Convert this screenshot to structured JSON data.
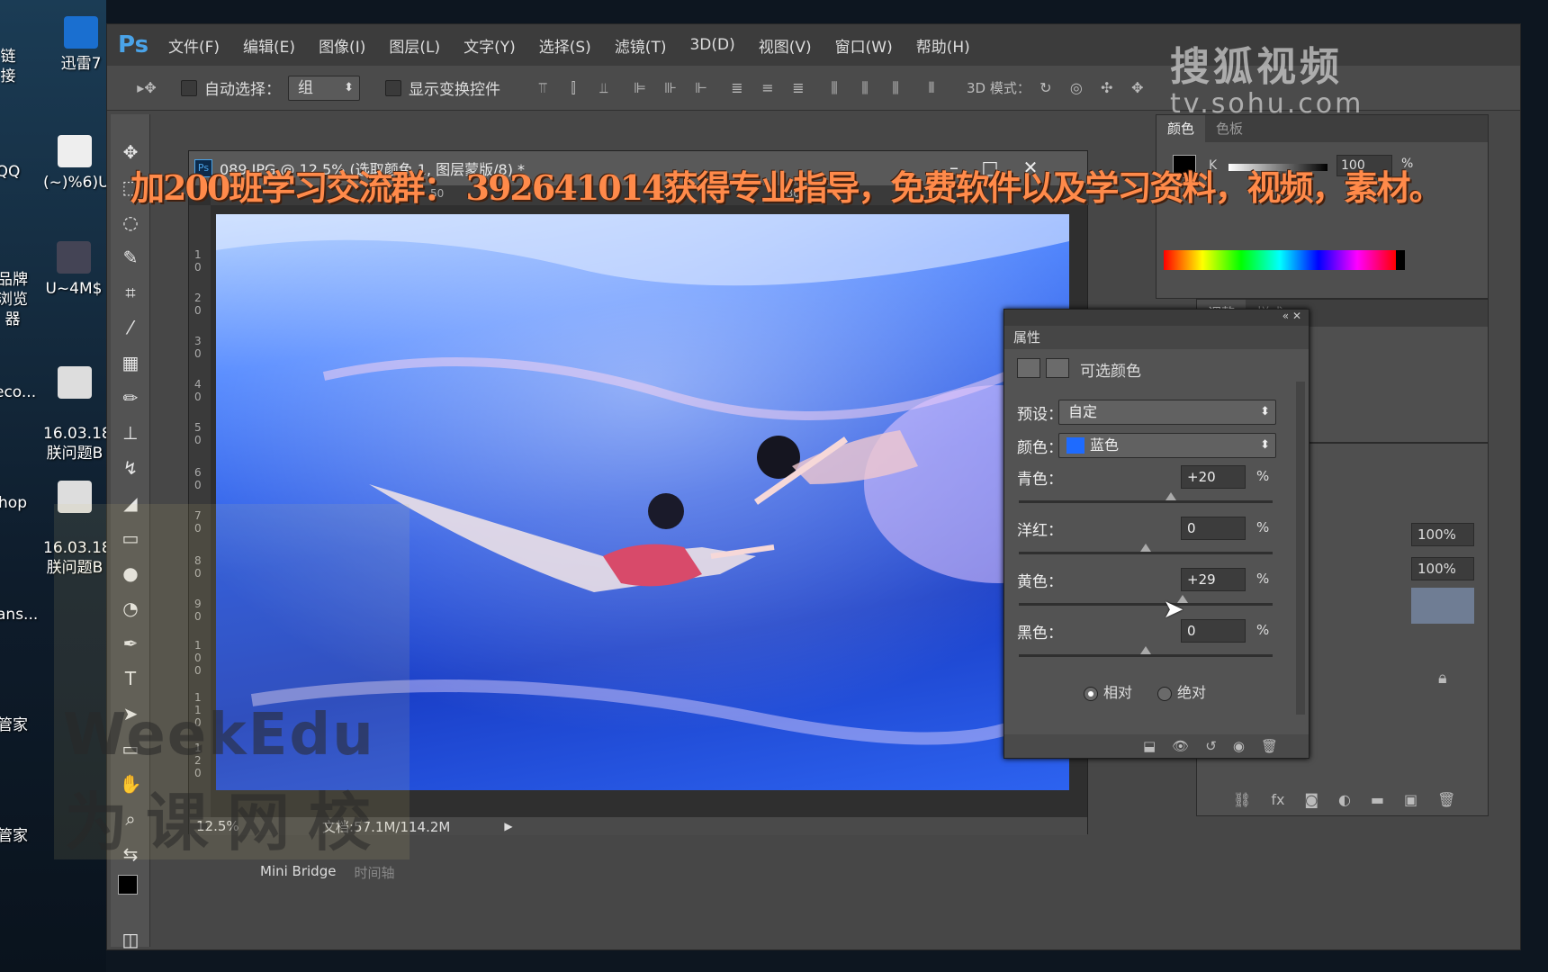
{
  "desktop": {
    "icons": [
      {
        "label": "迅雷7"
      },
      {
        "label": "链接"
      },
      {
        "label": "QQ"
      },
      {
        "label": "(~)%6)U"
      },
      {
        "label": "品牌浏览器"
      },
      {
        "label": "U~4M$"
      },
      {
        "label": "eco..."
      },
      {
        "label": "16.03.18\n朕问题B"
      },
      {
        "label": "hop"
      },
      {
        "label": "16.03.18\n朕问题B"
      },
      {
        "label": "ans..."
      },
      {
        "label": "管家"
      },
      {
        "label": "管家"
      }
    ]
  },
  "app": {
    "logo": "Ps",
    "menu": [
      "文件(F)",
      "编辑(E)",
      "图像(I)",
      "图层(L)",
      "文字(Y)",
      "选择(S)",
      "滤镜(T)",
      "3D(D)",
      "视图(V)",
      "窗口(W)",
      "帮助(H)"
    ]
  },
  "options": {
    "auto_select_label": "自动选择：",
    "auto_select_value": "组",
    "show_transform_label": "显示变换控件",
    "mode_3d_label": "3D 模式："
  },
  "document": {
    "tab_title": "089.JPG @ 12.5% (选取颜色 1, 图层蒙版/8) *",
    "zoom": "12.5%",
    "doc_size": "文档:57.1M/114.2M",
    "ruler_top": [
      "50",
      "130"
    ],
    "ruler_left": [
      "1 0",
      "2 0",
      "3 0",
      "4 0",
      "5 0",
      "6 0",
      "7 0",
      "8 0",
      "9 0",
      "1 0 0",
      "1 1 0",
      "1 2 0"
    ]
  },
  "color_panel": {
    "tabs": [
      "颜色",
      "色板"
    ],
    "k_label": "K",
    "k_value": "100",
    "pct": "%"
  },
  "adj_panel": {
    "tabs": [
      "调整",
      "样式"
    ]
  },
  "layers_panel": {
    "opacity": "100%",
    "fill": "100%"
  },
  "properties": {
    "title": "属性",
    "adj_name": "可选颜色",
    "preset_label": "预设：",
    "preset_value": "自定",
    "colors_label": "颜色：",
    "colors_value": "蓝色",
    "swatch_color": "#1e6bff",
    "sliders": [
      {
        "label": "青色：",
        "value": "+20",
        "level": 0.6
      },
      {
        "label": "洋红：",
        "value": "0",
        "level": 0.5
      },
      {
        "label": "黄色：",
        "value": "+29",
        "level": 0.645
      },
      {
        "label": "黑色：",
        "value": "0",
        "level": 0.5
      }
    ],
    "pct": "%",
    "mode_relative": "相对",
    "mode_absolute": "绝对"
  },
  "bottom_tabs": [
    "Mini Bridge",
    "时间轴"
  ],
  "overlays": {
    "banner": "加200班学习交流群：  392641014获得专业指导，免费软件以及学习资料，视频，素材。",
    "sohu_logo": "搜狐视频",
    "sohu_url": "tv.sohu.com",
    "weekedu_en": "WeekEdu",
    "weekedu_cn": "为课网校"
  }
}
